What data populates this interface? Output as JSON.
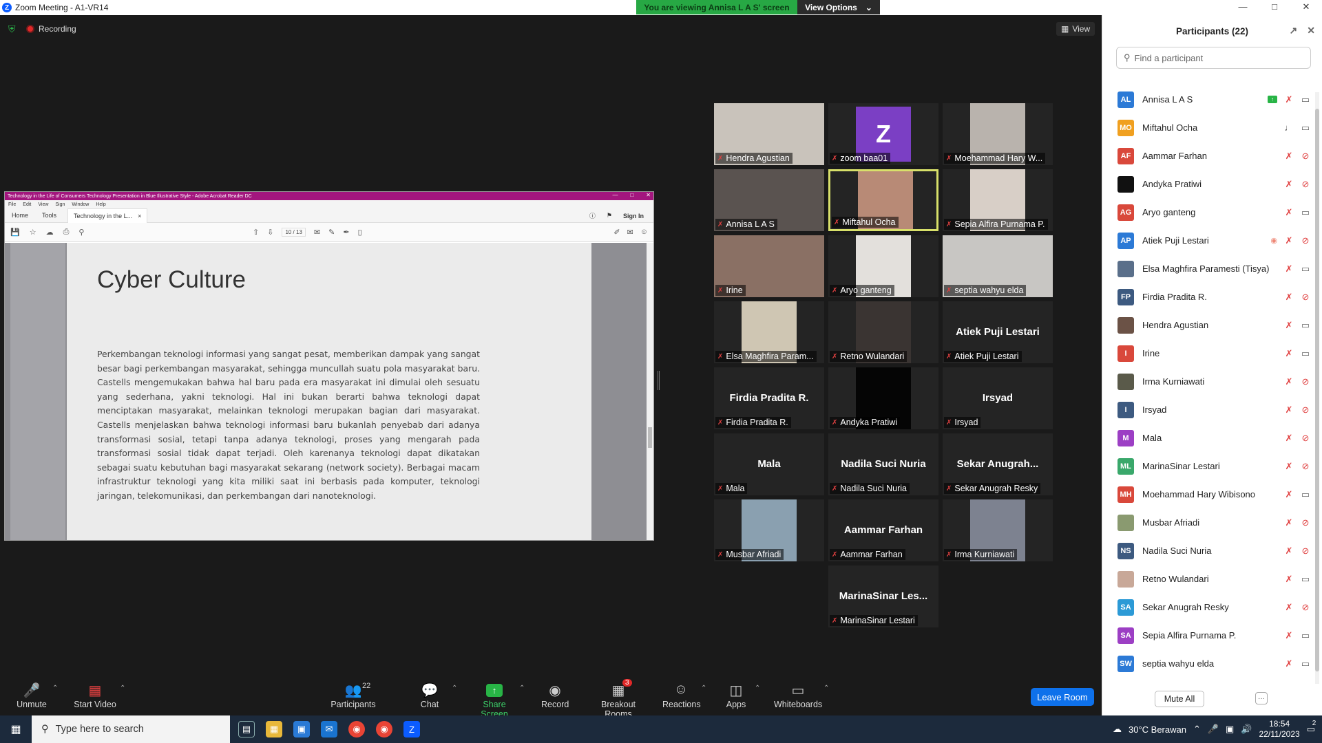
{
  "window": {
    "title": "Zoom Meeting - A1-VR14",
    "viewing_banner": "You are viewing Annisa L A S' screen",
    "view_options": "View Options"
  },
  "meeting": {
    "recording_label": "Recording",
    "view_label": "View"
  },
  "acrobat": {
    "title": "Technology in the Life of Consumers Technology Presentation in Blue Illustrative Style - Adobe Acrobat Reader DC",
    "menu": [
      "File",
      "Edit",
      "View",
      "Sign",
      "Window",
      "Help"
    ],
    "tabs": [
      "Home",
      "Tools"
    ],
    "doc_tab": "Technology in the L...",
    "sign_in": "Sign In",
    "page_indicator": "10 / 13",
    "slide_title": "Cyber Culture",
    "slide_body": "Perkembangan teknologi informasi yang sangat pesat, memberikan dampak yang sangat besar bagi perkembangan masyarakat, sehingga muncullah suatu pola masyarakat baru. Castells mengemukakan bahwa hal baru pada era masyarakat ini dimulai oleh sesuatu yang sederhana, yakni teknologi. Hal ini bukan berarti bahwa teknologi dapat menciptakan masyarakat, melainkan teknologi merupakan bagian dari masyarakat. Castells menjelaskan bahwa teknologi informasi baru bukanlah penyebab dari adanya transformasi sosial, tetapi tanpa adanya teknologi, proses yang mengarah pada transformasi sosial tidak dapat terjadi. Oleh karenanya teknologi dapat dikatakan sebagai suatu kebutuhan bagi masyarakat sekarang (network society). Berbagai macam infrastruktur teknologi yang kita miliki saat ini berbasis pada komputer, teknologi jaringan, telekomunikasi, dan perkembangan dari nanoteknologi."
  },
  "video_tiles": [
    {
      "name": "Hendra Agustian",
      "type": "video",
      "color": "#c9c3bb"
    },
    {
      "name": "zoom baa01",
      "type": "initial",
      "initial": "Z"
    },
    {
      "name": "Moehammad Hary W...",
      "type": "video",
      "color": "#b9b3ad"
    },
    {
      "name": "Annisa L A S",
      "type": "video",
      "color": "#5a5350"
    },
    {
      "name": "Miftahul Ocha",
      "type": "video",
      "color": "#b88a76",
      "active": true
    },
    {
      "name": "Sepia Alfira Purnama P.",
      "type": "video",
      "color": "#d8cfc7"
    },
    {
      "name": "Irine",
      "type": "video",
      "color": "#8a7064"
    },
    {
      "name": "Aryo ganteng",
      "type": "video",
      "color": "#e3e0dc"
    },
    {
      "name": "septia wahyu elda",
      "type": "video",
      "color": "#c8c6c3"
    },
    {
      "name": "Elsa Maghfira Param...",
      "type": "video",
      "color": "#cfc6b3"
    },
    {
      "name": "Retno Wulandari",
      "type": "video",
      "color": "#3a3432"
    },
    {
      "name": "Atiek Puji Lestari",
      "type": "name",
      "big": "Atiek Puji Lestari"
    },
    {
      "name": "Firdia Pradita R.",
      "type": "name",
      "big": "Firdia Pradita R."
    },
    {
      "name": "Andyka Pratiwi",
      "type": "video",
      "color": "#050505"
    },
    {
      "name": "Irsyad",
      "type": "name",
      "big": "Irsyad"
    },
    {
      "name": "Mala",
      "type": "name",
      "big": "Mala"
    },
    {
      "name": "Nadila Suci Nuria",
      "type": "name",
      "big": "Nadila Suci Nuria"
    },
    {
      "name": "Sekar Anugrah Resky",
      "type": "name",
      "big": "Sekar  Anugrah..."
    },
    {
      "name": "Musbar Afriadi",
      "type": "video",
      "color": "#8aa0b0"
    },
    {
      "name": "Aammar Farhan",
      "type": "name",
      "big": "Aammar Farhan"
    },
    {
      "name": "Irma Kurniawati",
      "type": "video",
      "color": "#7d8290"
    },
    {
      "name": "MarinaSinar Lestari",
      "type": "name",
      "big": "MarinaSinar  Les..."
    }
  ],
  "toolbar": {
    "unmute": "Unmute",
    "start_video": "Start Video",
    "participants": "Participants",
    "participants_count": "22",
    "chat": "Chat",
    "share_screen": "Share Screen",
    "record": "Record",
    "breakout_rooms": "Breakout Rooms",
    "breakout_badge": "3",
    "reactions": "Reactions",
    "apps": "Apps",
    "whiteboards": "Whiteboards",
    "leave_room": "Leave Room"
  },
  "participants_panel": {
    "title": "Participants (22)",
    "search_placeholder": "Find a participant",
    "mute_all": "Mute All",
    "list": [
      {
        "initials": "AL",
        "name": "Annisa L A S",
        "color": "#2c7ad6",
        "sharing": true,
        "mic": "off",
        "cam": "on"
      },
      {
        "initials": "MO",
        "name": "Miftahul Ocha",
        "color": "#f0a020",
        "mic": "on",
        "cam": "on"
      },
      {
        "initials": "AF",
        "name": "Aammar Farhan",
        "color": "#d9483b",
        "mic": "off",
        "cam": "off"
      },
      {
        "initials": "",
        "name": "Andyka Pratiwi",
        "color": "#111111",
        "mic": "off",
        "cam": "off"
      },
      {
        "initials": "AG",
        "name": "Aryo ganteng",
        "color": "#d9483b",
        "mic": "off",
        "cam": "on"
      },
      {
        "initials": "AP",
        "name": "Atiek Puji Lestari",
        "color": "#2c7ad6",
        "spotlight": true,
        "mic": "off",
        "cam": "off"
      },
      {
        "initials": "",
        "name": "Elsa Maghfira Paramesti (Tisya)",
        "color": "#5a6f8a",
        "mic": "off",
        "cam": "on"
      },
      {
        "initials": "FP",
        "name": "Firdia Pradita R.",
        "color": "#3d5a80",
        "mic": "off",
        "cam": "off"
      },
      {
        "initials": "",
        "name": "Hendra Agustian",
        "color": "#6b5246",
        "mic": "off",
        "cam": "on"
      },
      {
        "initials": "I",
        "name": "Irine",
        "color": "#d9483b",
        "mic": "off",
        "cam": "on"
      },
      {
        "initials": "",
        "name": "Irma Kurniawati",
        "color": "#5a5a4a",
        "mic": "off",
        "cam": "off"
      },
      {
        "initials": "I",
        "name": "Irsyad",
        "color": "#3d5a80",
        "mic": "off",
        "cam": "off"
      },
      {
        "initials": "M",
        "name": "Mala",
        "color": "#9c3fc4",
        "mic": "off",
        "cam": "off"
      },
      {
        "initials": "ML",
        "name": "MarinaSinar Lestari",
        "color": "#3aa86b",
        "mic": "off",
        "cam": "off"
      },
      {
        "initials": "MH",
        "name": "Moehammad Hary Wibisono",
        "color": "#d9483b",
        "mic": "off",
        "cam": "on"
      },
      {
        "initials": "",
        "name": "Musbar Afriadi",
        "color": "#8a9a70",
        "mic": "off",
        "cam": "off"
      },
      {
        "initials": "NS",
        "name": "Nadila Suci Nuria",
        "color": "#3d5a80",
        "mic": "off",
        "cam": "off"
      },
      {
        "initials": "",
        "name": "Retno Wulandari",
        "color": "#c8a898",
        "mic": "off",
        "cam": "on"
      },
      {
        "initials": "SA",
        "name": "Sekar Anugrah Resky",
        "color": "#2c9ad6",
        "mic": "off",
        "cam": "off"
      },
      {
        "initials": "SA",
        "name": "Sepia Alfira Purnama P.",
        "color": "#9c3fc4",
        "mic": "off",
        "cam": "on"
      },
      {
        "initials": "SW",
        "name": "septia wahyu elda",
        "color": "#2c7ad6",
        "mic": "off",
        "cam": "on"
      }
    ]
  },
  "taskbar": {
    "search_placeholder": "Type here to search",
    "weather": "30°C  Berawan",
    "time": "18:54",
    "date": "22/11/2023",
    "notification_count": "2"
  }
}
